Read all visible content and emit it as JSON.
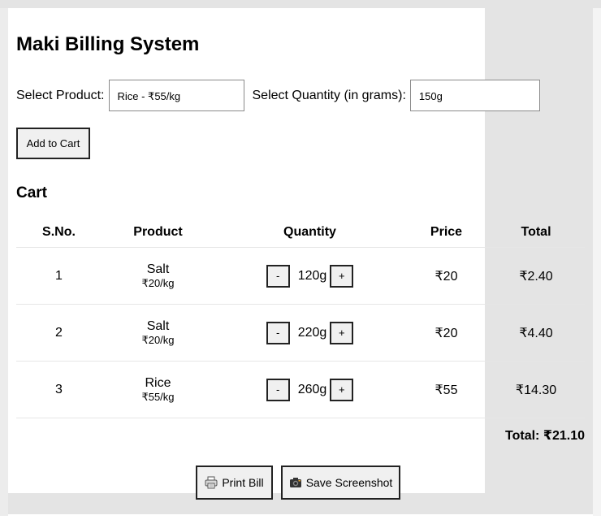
{
  "app": {
    "title": "Maki Billing System"
  },
  "form": {
    "product_label": "Select Product:",
    "product_value": "Rice - ₹55/kg",
    "quantity_label": "Select Quantity (in grams):",
    "quantity_value": "150g",
    "add_button_label": "Add to Cart"
  },
  "cart": {
    "heading": "Cart",
    "columns": [
      "S.No.",
      "Product",
      "Quantity",
      "Price",
      "Total"
    ],
    "rows": [
      {
        "sno": "1",
        "product": "Salt",
        "rate": "₹20/kg",
        "decrement": "-",
        "quantity": "120g",
        "increment": "+",
        "price": "₹20",
        "total": "₹2.40"
      },
      {
        "sno": "2",
        "product": "Salt",
        "rate": "₹20/kg",
        "decrement": "-",
        "quantity": "220g",
        "increment": "+",
        "price": "₹20",
        "total": "₹4.40"
      },
      {
        "sno": "3",
        "product": "Rice",
        "rate": "₹55/kg",
        "decrement": "-",
        "quantity": "260g",
        "increment": "+",
        "price": "₹55",
        "total": "₹14.30"
      }
    ],
    "grand_total": "Total: ₹21.10"
  },
  "actions": {
    "print_label": "Print Bill",
    "print_icon": "printer-icon",
    "save_label": "Save Screenshot",
    "save_icon": "camera-icon"
  }
}
